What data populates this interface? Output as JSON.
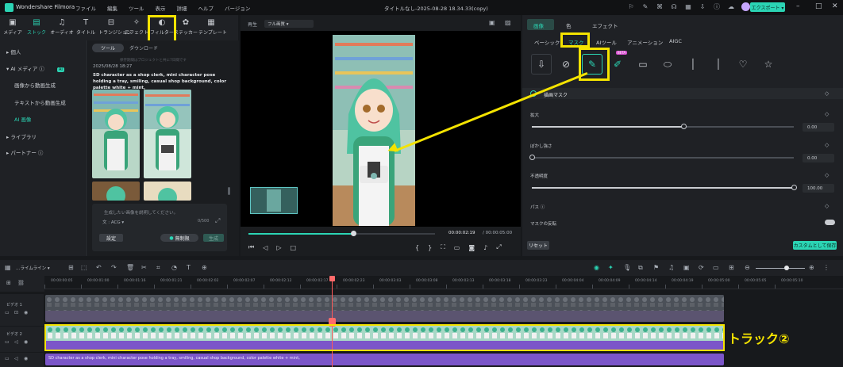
{
  "titlebar": {
    "app_name": "Wondershare Filmora",
    "menus": [
      "ファイル",
      "編集",
      "ツール",
      "表示",
      "詳細",
      "ヘルプ",
      "バージョン"
    ],
    "doc_title": "タイトルなし-2025-08-28 18.34.33(copy)",
    "export_label": "エクスポート ▾",
    "icons": [
      "gift-icon",
      "brush-icon",
      "tag-icon",
      "headset-icon",
      "grid-icon",
      "download-icon",
      "info-icon",
      "cloud-icon",
      "avatar-icon"
    ],
    "accent": "#2bd4b4"
  },
  "media_tabs": [
    {
      "label": "メディア",
      "icon": "▣"
    },
    {
      "label": "ストック",
      "icon": "▤",
      "active": true
    },
    {
      "label": "オーディオ",
      "icon": "♫"
    },
    {
      "label": "タイトル",
      "icon": "T"
    },
    {
      "label": "トランジション",
      "icon": "⊟"
    },
    {
      "label": "エフェクト",
      "icon": "✧"
    },
    {
      "label": "フィルター",
      "icon": "◐"
    },
    {
      "label": "ステッカー",
      "icon": "✿"
    },
    {
      "label": "テンプレート",
      "icon": "▦"
    }
  ],
  "sidebar": {
    "items": [
      {
        "label": "▸ 個人"
      },
      {
        "label": "▾ AI メディア ⓘ",
        "badge": "AI"
      },
      {
        "label": "画像から動画生成",
        "sub": true
      },
      {
        "label": "テキストから動画生成",
        "sub": true
      },
      {
        "label": "AI 画像",
        "sub": true,
        "active": true
      },
      {
        "label": "▸ ライブラリ"
      },
      {
        "label": "▸ パートナー ⓘ"
      }
    ]
  },
  "content": {
    "tab_tool": "ツール",
    "tab_download": "ダウンロード",
    "faded_note": "保存期間はプロジェクトと共に7日間です",
    "date": "2025/08/28 18:27",
    "description": "SD character as a shop clerk, mini character pose holding a tray, smiling, casual shop background, color palette white + mint,",
    "prompt_placeholder": "生成したい画像を説明してください。",
    "style_label": "文 : ACG ▾",
    "counter": "0/500",
    "settings_label": "設定",
    "free_badge": "無制限",
    "generate_label": "生成"
  },
  "preview": {
    "label": "再生",
    "quality": "フル画質 ▾",
    "time_current": "00:00:02:19",
    "time_total": "/ 00:00:05:00",
    "progress": 0.56
  },
  "props": {
    "top_tabs": [
      "画像",
      "色",
      "エフェクト"
    ],
    "sub_tabs": [
      "ベーシック",
      "マスク",
      "AIツール",
      "アニメーション",
      "AIGC"
    ],
    "section_title": "描画マスク",
    "rows": [
      {
        "label": "拡大",
        "value": "0.00",
        "level": 0.58
      },
      {
        "label": "ぼかし強さ",
        "value": "0.00",
        "level": 0.0
      },
      {
        "label": "不透明度",
        "value": "100.00",
        "level": 1.0
      }
    ],
    "path_label": "パス ⓘ",
    "invert_label": "マスクの反転",
    "reset_label": "リセット",
    "save_label": "カスタムとして保存",
    "shape_icons": [
      "import-mask-icon",
      "circle-slash-icon",
      "pen-mask-icon",
      "brush-mask-icon",
      "rectangle-icon",
      "ellipse-icon",
      "line-icon",
      "line-icon",
      "heart-icon",
      "star-icon"
    ],
    "beta_badge": "BETA"
  },
  "timeline": {
    "toolbar_label": "…ライムライン ▾",
    "ruler": [
      "00:00:00:05",
      "00:00:01:00",
      "00:00:01:16",
      "00:00:01:21",
      "00:00:02:02",
      "00:00:02:07",
      "00:00:02:12",
      "00:00:02:17",
      "00:00:02:23",
      "00:00:03:03",
      "00:00:03:08",
      "00:00:03:13",
      "00:00:03:18",
      "00:00:03:23",
      "00:00:04:04",
      "00:00:04:09",
      "00:00:04:14",
      "00:00:04:19",
      "00:00:05:00",
      "00:00:05:05",
      "00:00:05:10"
    ],
    "track1_label": "ビデオ 1",
    "track2_label": "ビデオ 2",
    "clip_caption": "SD character as a shop clerk, mini character pose holding a tray, smiling, casual shop background, color palette white + mint,",
    "annotation": "トラック②"
  }
}
